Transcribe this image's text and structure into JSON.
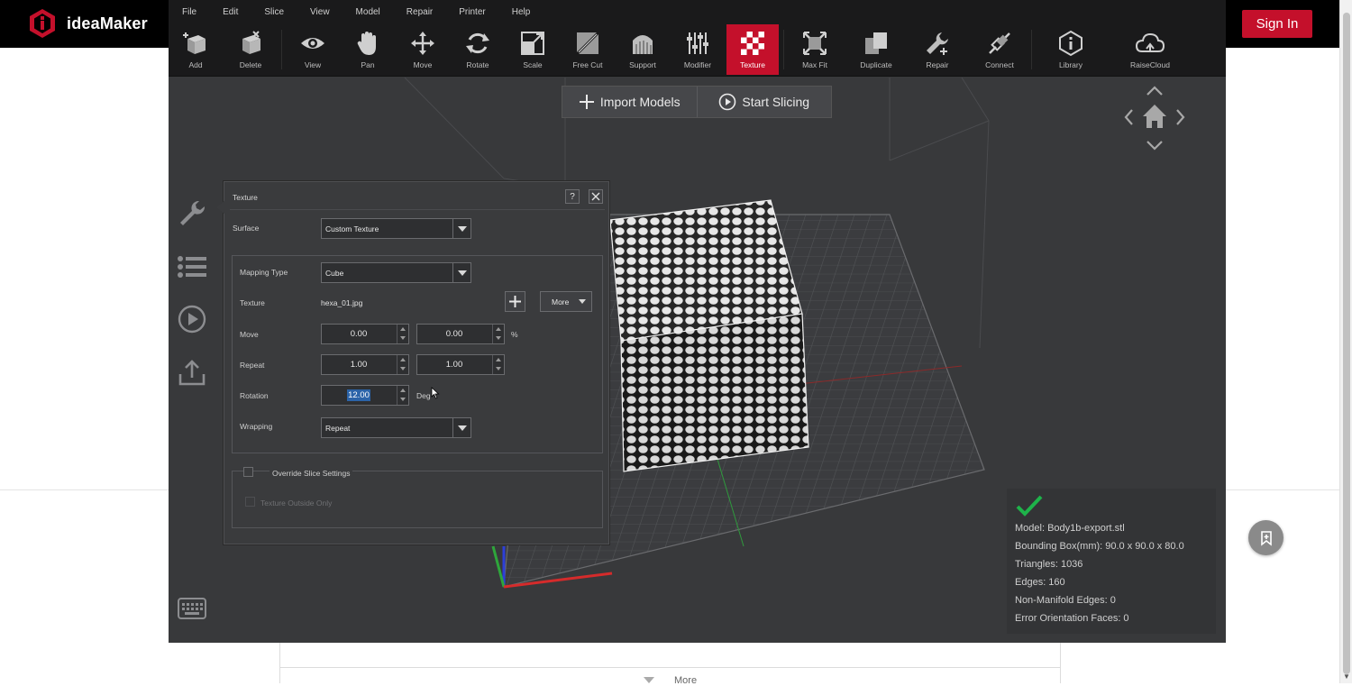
{
  "site": {
    "brand": "ideaMaker",
    "signin_label": "Sign In",
    "more_label": "More"
  },
  "menu": [
    "File",
    "Edit",
    "Slice",
    "View",
    "Model",
    "Repair",
    "Printer",
    "Help"
  ],
  "toolbar": {
    "items": [
      {
        "name": "add",
        "label": "Add"
      },
      {
        "name": "delete",
        "label": "Delete"
      },
      {
        "name": "view",
        "label": "View"
      },
      {
        "name": "pan",
        "label": "Pan"
      },
      {
        "name": "move",
        "label": "Move"
      },
      {
        "name": "rotate",
        "label": "Rotate"
      },
      {
        "name": "scale",
        "label": "Scale"
      },
      {
        "name": "free-cut",
        "label": "Free Cut"
      },
      {
        "name": "support",
        "label": "Support"
      },
      {
        "name": "modifier",
        "label": "Modifier"
      },
      {
        "name": "texture",
        "label": "Texture",
        "active": true
      },
      {
        "name": "max-fit",
        "label": "Max Fit"
      },
      {
        "name": "duplicate",
        "label": "Duplicate"
      },
      {
        "name": "repair",
        "label": "Repair"
      },
      {
        "name": "connect",
        "label": "Connect"
      },
      {
        "name": "library",
        "label": "Library"
      },
      {
        "name": "raisecloud",
        "label": "RaiseCloud"
      }
    ]
  },
  "viewport": {
    "import_label": "Import Models",
    "slice_label": "Start Slicing"
  },
  "dialog": {
    "title": "Texture",
    "help": "?",
    "surface_label": "Surface",
    "surface_value": "Custom Texture",
    "mapping_label": "Mapping Type",
    "mapping_value": "Cube",
    "texture_label": "Texture",
    "texture_file": "hexa_01.jpg",
    "more_label": "More",
    "move_label": "Move",
    "move_x": "0.00",
    "move_y": "0.00",
    "move_unit": "%",
    "repeat_label": "Repeat",
    "repeat_x": "1.00",
    "repeat_y": "1.00",
    "rotation_label": "Rotation",
    "rotation_value": "12.00",
    "rotation_unit": "Deg",
    "wrapping_label": "Wrapping",
    "wrapping_value": "Repeat",
    "override_label": "Override Slice Settings",
    "outside_label": "Texture Outside Only"
  },
  "model_info": {
    "model": "Model: Body1b-export.stl",
    "bbox": "Bounding Box(mm): 90.0 x 90.0 x 80.0",
    "triangles": "Triangles: 1036",
    "edges": "Edges: 160",
    "non_manifold": "Non-Manifold Edges: 0",
    "error_faces": "Error Orientation Faces: 0"
  },
  "colors": {
    "accent": "#c4102b",
    "app_bg": "#38393b",
    "toolbar_bg": "#1a1a1b",
    "check_green": "#1eb34a"
  }
}
